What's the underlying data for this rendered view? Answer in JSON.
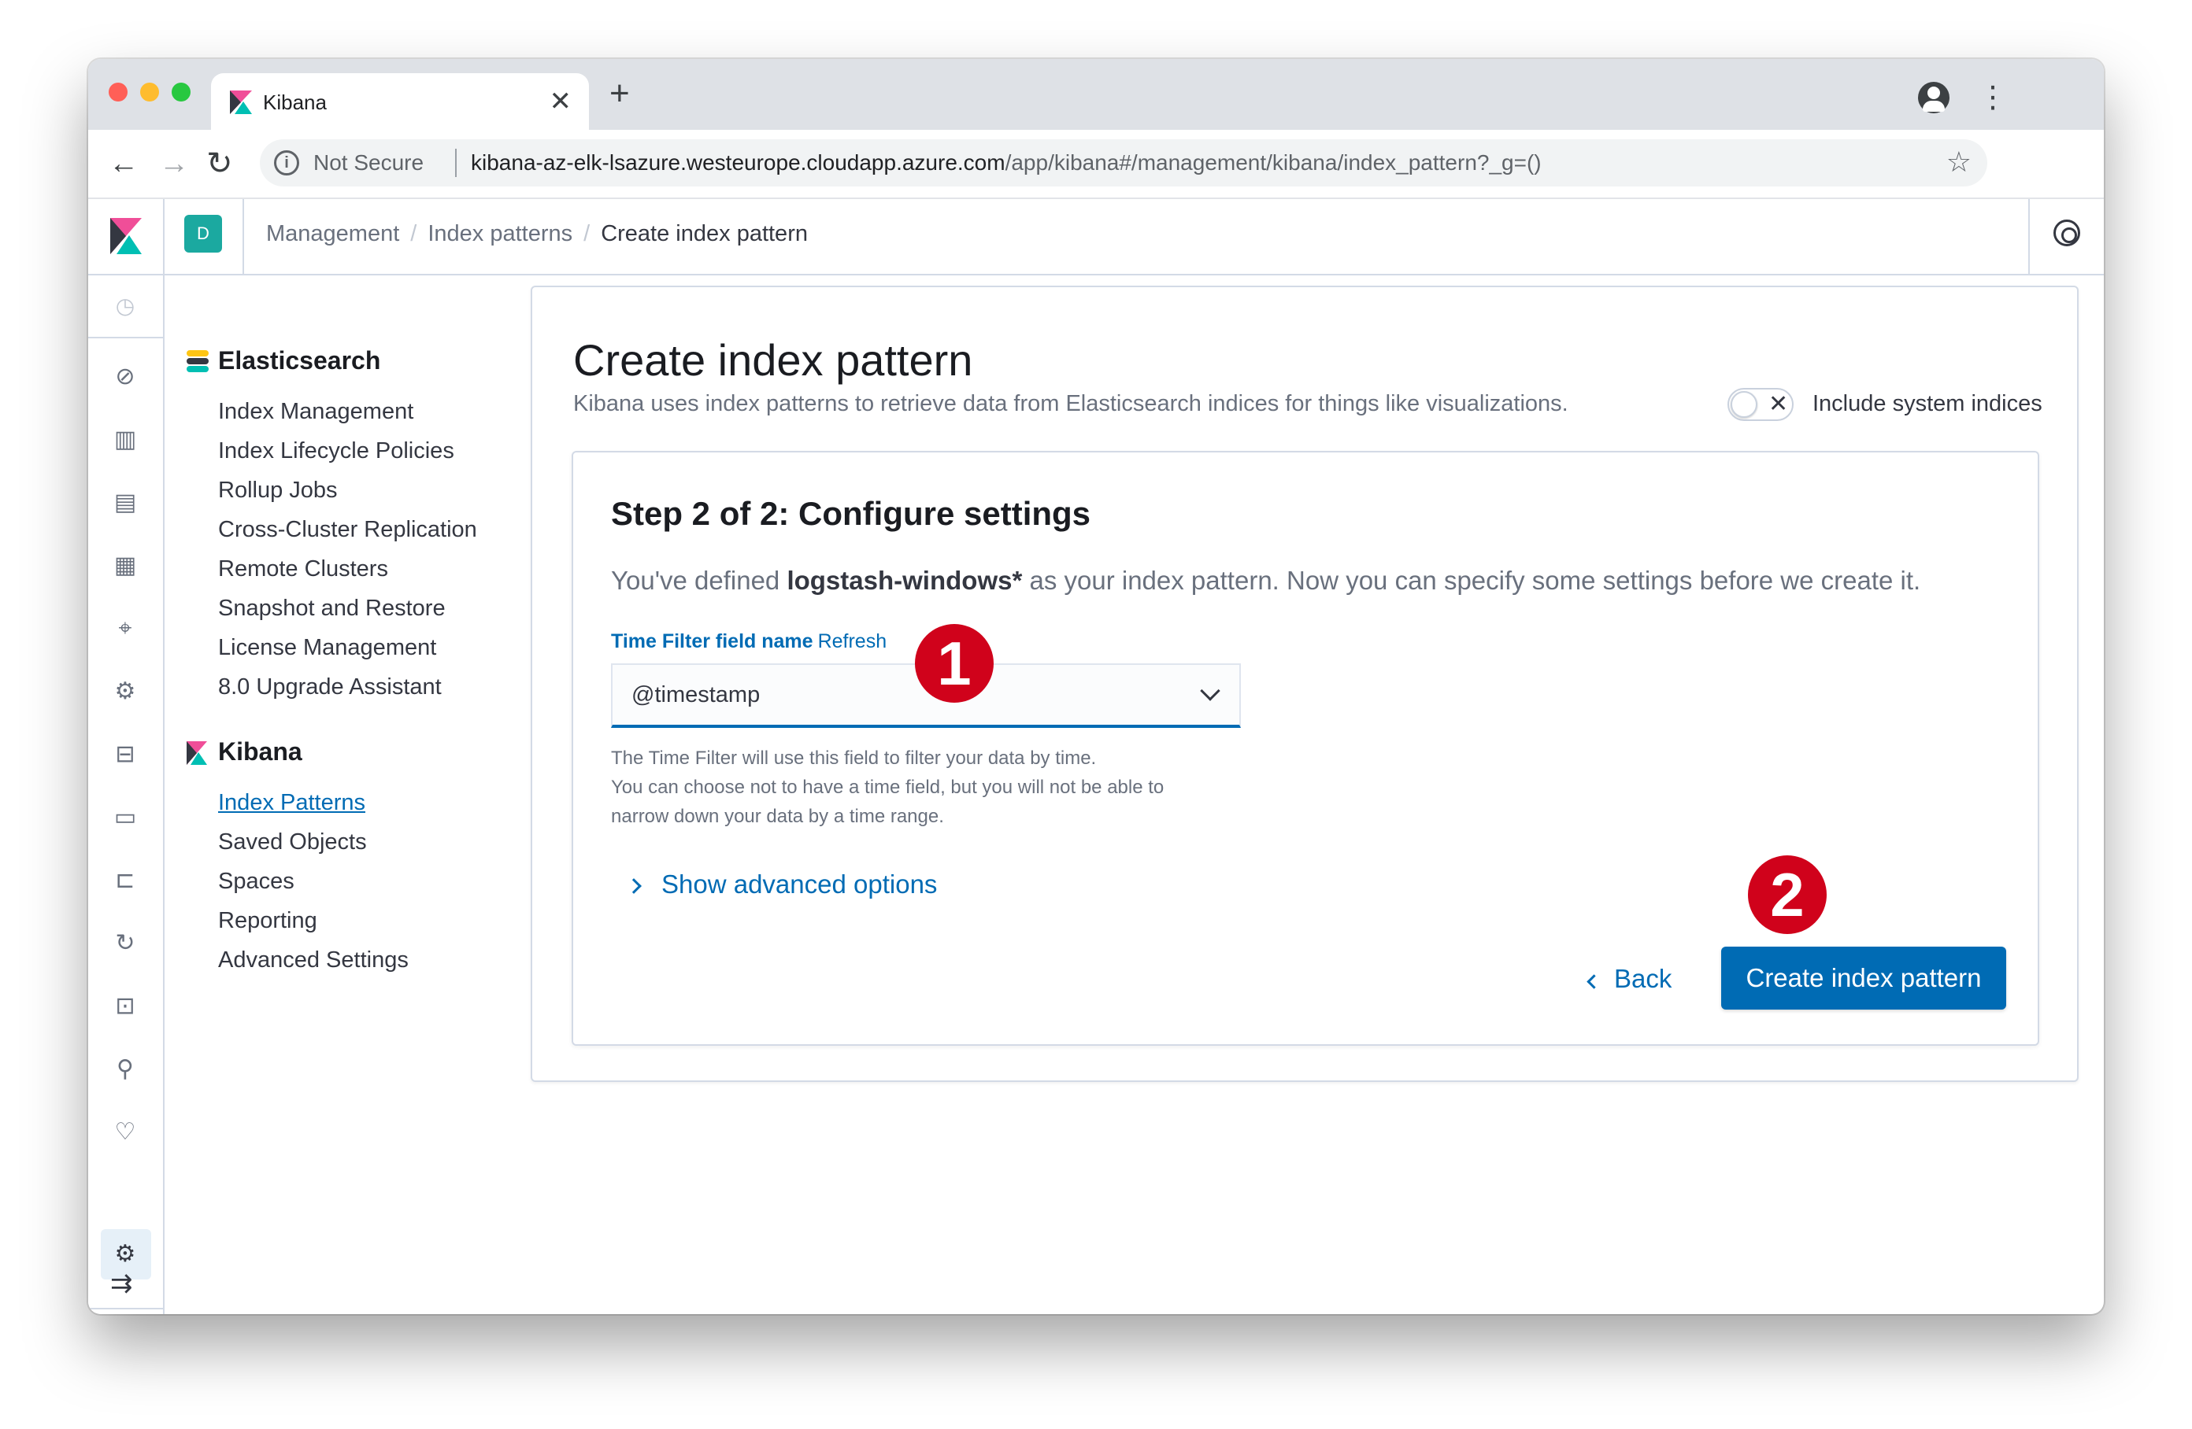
{
  "browser": {
    "tab_title": "Kibana",
    "omnibox": {
      "security_label": "Not Secure",
      "url_host": "kibana-az-elk-lsazure.westeurope.cloudapp.azure.com",
      "url_path": "/app/kibana#/management/kibana/index_pattern?_g=()"
    }
  },
  "header": {
    "space_initial": "D",
    "breadcrumbs": [
      "Management",
      "Index patterns",
      "Create index pattern"
    ]
  },
  "sidenav": {
    "elasticsearch": {
      "title": "Elasticsearch",
      "items": [
        "Index Management",
        "Index Lifecycle Policies",
        "Rollup Jobs",
        "Cross-Cluster Replication",
        "Remote Clusters",
        "Snapshot and Restore",
        "License Management",
        "8.0 Upgrade Assistant"
      ]
    },
    "kibana": {
      "title": "Kibana",
      "items": [
        "Index Patterns",
        "Saved Objects",
        "Spaces",
        "Reporting",
        "Advanced Settings"
      ],
      "active_item": "Index Patterns"
    }
  },
  "rail": {
    "icons": [
      "clock-icon",
      "compass-icon",
      "visualize-icon",
      "dashboard-icon",
      "canvas-icon",
      "maps-icon",
      "ml-icon",
      "infrastructure-icon",
      "logs-icon",
      "apm-icon",
      "uptime-icon",
      "siem-icon",
      "dev-tools-icon",
      "monitoring-icon",
      "gear-icon",
      "collapse-icon"
    ]
  },
  "main": {
    "title": "Create index pattern",
    "description": "Kibana uses index patterns to retrieve data from Elasticsearch indices for things like visualizations.",
    "include_system_indices_label": "Include system indices",
    "include_system_indices_on": false,
    "step": {
      "title": "Step 2 of 2: Configure settings",
      "desc_prefix": "You've defined",
      "pattern": "logstash-windows*",
      "desc_suffix": "as your index pattern. Now you can specify some settings before we create it.",
      "field_label": "Time Filter field name",
      "refresh_link": "Refresh",
      "time_field_value": "@timestamp",
      "help_lines": [
        "The Time Filter will use this field to filter your data by time.",
        "You can choose not to have a time field, but you will not be able to",
        "narrow down your data by a time range."
      ],
      "advanced_label": "Show advanced options",
      "back_label": "Back",
      "create_label": "Create index pattern"
    }
  },
  "annotations": {
    "marker_1": "1",
    "marker_2": "2"
  },
  "colors": {
    "primary": "#006bb4",
    "marker": "#d0021b",
    "space_badge": "#1ba9a0"
  }
}
